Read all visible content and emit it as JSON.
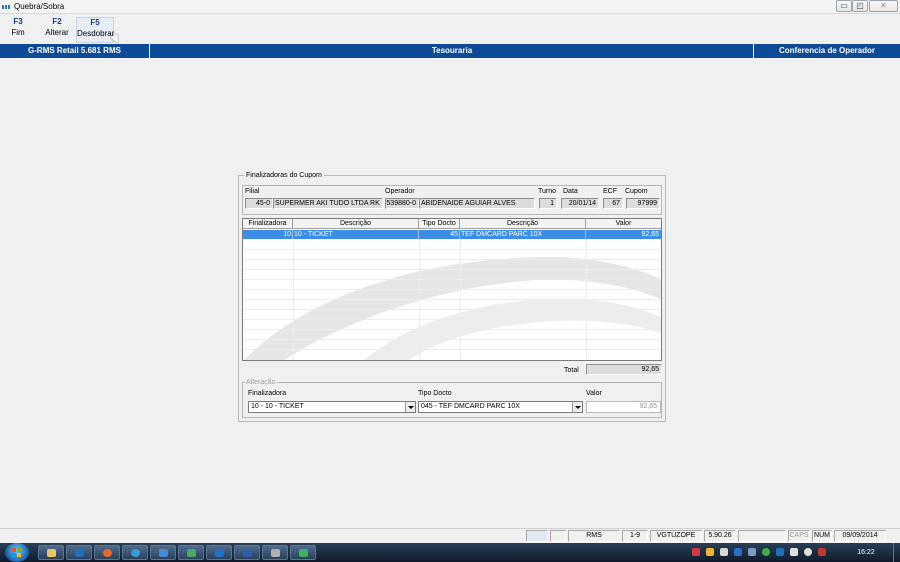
{
  "window": {
    "title": "Quebra/Sobra",
    "controls": {
      "minimize": "▭",
      "maximize": "◰",
      "close": "✕"
    }
  },
  "toolbar": {
    "buttons": [
      {
        "key": "F3",
        "label": "Fim"
      },
      {
        "key": "F2",
        "label": "Alterar"
      },
      {
        "key": "F5",
        "label": "Desdobrar"
      }
    ]
  },
  "header": {
    "product": "G-RMS Retail 5.681 RMS",
    "module": "Tesouraria",
    "screen": "Conferencia de Operador"
  },
  "panel": {
    "legend": "Finalizadoras do Cupom",
    "info": {
      "filial_label": "Filial",
      "filial_code": "45-0",
      "filial_name": "SUPERMER AKI TUDO LTDA RK",
      "operador_label": "Operador",
      "operador_code": "539880-0",
      "operador_name": "ABIDENAIDE AGUIAR ALVES",
      "turno_label": "Turno",
      "turno": "1",
      "data_label": "Data",
      "data": "20/01/14",
      "ecf_label": "ECF",
      "ecf": "67",
      "cupom_label": "Cupom",
      "cupom": "97999"
    },
    "grid": {
      "columns": [
        "Finalizadora",
        "Descrição",
        "Tipo Docto",
        "Descrição",
        "Valor"
      ],
      "rows": [
        {
          "finalizadora": "10",
          "descricao": "10 - TICKET",
          "tipo_docto": "45",
          "descricao2": "TEF DMCARD PARC 10X",
          "valor": "92,65"
        }
      ]
    },
    "total_label": "Total",
    "total_value": "92,65",
    "alteracao": {
      "legend": "Alteração",
      "finalizadora_label": "Finalizadora",
      "finalizadora_value": "10 - 10 - TICKET",
      "tipo_docto_label": "Tipo Docto",
      "tipo_docto_value": "045 - TEF DMCARD PARC 10X",
      "valor_label": "Valor",
      "valor_value": "92,65"
    }
  },
  "statusbar": {
    "items": [
      "RMS",
      "1-9",
      "VGTUZOPE",
      "5.90.26",
      "",
      "CAPS",
      "NUM",
      "09/09/2014"
    ]
  },
  "taskbar": {
    "time": "16:22"
  },
  "colors": {
    "header_bg": "#0e4b97",
    "selection": "#3b8ee6",
    "taskbar": "#1c2d42"
  }
}
